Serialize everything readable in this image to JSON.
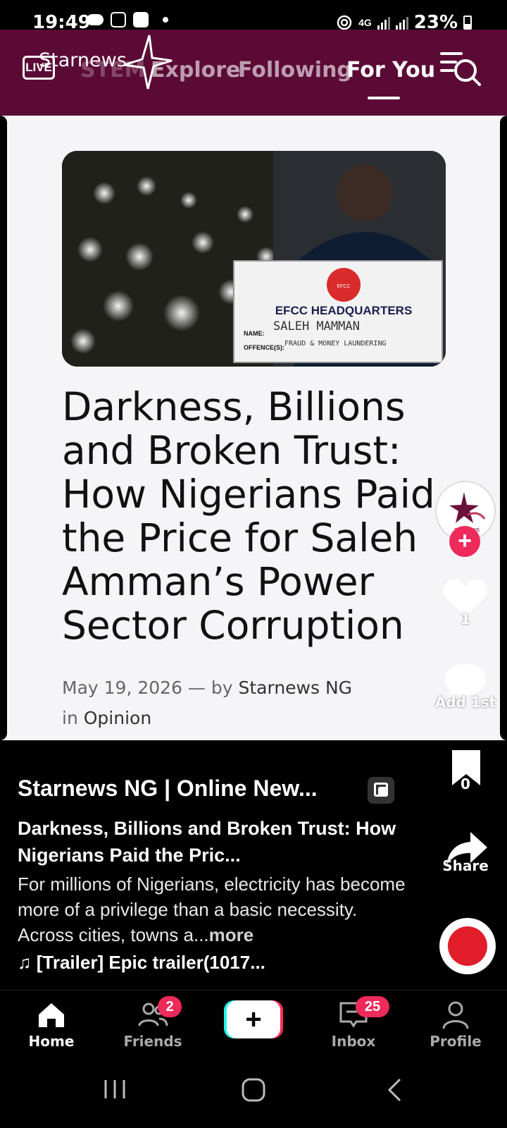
{
  "status_bar": {
    "time": "19:49",
    "network": "4G",
    "battery": "23%",
    "icons": [
      "weather-cloud-icon",
      "instagram-icon",
      "checkbox-icon",
      "dot-icon",
      "hotspot-icon",
      "signal-icon",
      "battery-icon"
    ]
  },
  "top_nav": {
    "live_label": "LIVE",
    "brand_name": "Starnews",
    "tabs": [
      {
        "label": "STEM",
        "active": false
      },
      {
        "label": "Explore",
        "active": false
      },
      {
        "label": "Following",
        "active": false
      },
      {
        "label": "For You",
        "active": true
      }
    ],
    "search_icon": "menu-search-icon",
    "background_color": "#5b0a35"
  },
  "article": {
    "image": {
      "board_title": "EFCC HEADQUARTERS",
      "name_label": "NAME:",
      "name_value": "SALEH MAMMAN",
      "offence_label": "OFFENCE(S):",
      "offence_value": "FRAUD & MONEY LAUNDERING",
      "logo_text": "EFCC"
    },
    "headline": "Darkness, Billions and Broken Trust: How Nigerians Paid the Price for Saleh Amman’s Power Sector Corruption",
    "date": "May 19, 2026",
    "dash": "—",
    "by_label": "by",
    "author": "Starnews NG",
    "in_label": "in",
    "category": "Opinion"
  },
  "actions": {
    "avatar_text": "starnews",
    "likes": "1",
    "comments": "Add 1st",
    "bookmarks": "0",
    "share_label": "Share"
  },
  "caption": {
    "source": "Starnews NG | Online New...",
    "title": "Darkness, Billions and Broken Trust: How Nigerians Paid the Pric...",
    "description": "For millions of Nigerians, electricity has become more of a privilege than a basic necessity. Across cities, towns a...",
    "more_label": "more",
    "music_icon": "♫",
    "music": "[Trailer] Epic trailer(1017..."
  },
  "bottom_nav": {
    "items": [
      {
        "label": "Home",
        "icon": "home-icon",
        "active": true
      },
      {
        "label": "Friends",
        "icon": "friends-icon",
        "badge": "2"
      },
      {
        "label": "+",
        "icon": "create-icon"
      },
      {
        "label": "Inbox",
        "icon": "inbox-icon",
        "badge": "25"
      },
      {
        "label": "Profile",
        "icon": "profile-icon"
      }
    ]
  },
  "system_nav": {
    "buttons": [
      "recent-apps-icon",
      "home-circle-icon",
      "back-icon"
    ]
  },
  "colors": {
    "accent": "#ee2a5b",
    "brand": "#5b0a35",
    "cyan": "#25f4ee"
  }
}
